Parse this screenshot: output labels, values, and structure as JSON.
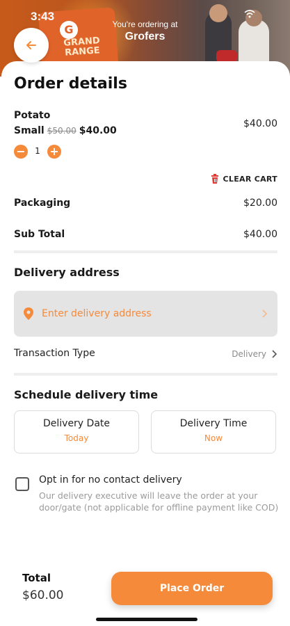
{
  "status_bar": {
    "time": "3:43"
  },
  "banner": {
    "ordering_at": "You're ordering at",
    "store_name": "Grofers",
    "bag_text": "GRAND RANGE",
    "bag_logo": "G"
  },
  "back_icon": "arrow-left-icon",
  "order": {
    "title": "Order details",
    "item": {
      "name": "Potato",
      "variant": "Small",
      "old_price": "$50.00",
      "new_price": "$40.00",
      "line_total": "$40.00",
      "quantity": "1",
      "minus": "−",
      "plus": "+"
    },
    "clear_cart": "CLEAR CART",
    "packaging_label": "Packaging",
    "packaging_value": "$20.00",
    "subtotal_label": "Sub Total",
    "subtotal_value": "$40.00"
  },
  "delivery": {
    "section_title": "Delivery address",
    "address_placeholder": "Enter delivery address",
    "transaction_label": "Transaction Type",
    "transaction_value": "Delivery"
  },
  "schedule": {
    "section_title": "Schedule delivery time",
    "date_label": "Delivery Date",
    "date_value": "Today",
    "time_label": "Delivery Time",
    "time_value": "Now"
  },
  "no_contact": {
    "title": "Opt in for no contact delivery",
    "description": "Our delivery executive will leave the order at your door/gate (not applicable for offline payment like COD)"
  },
  "footer": {
    "total_label": "Total",
    "total_value": "$60.00",
    "place_order": "Place Order"
  },
  "colors": {
    "accent": "#f58a3a",
    "danger": "#e53935"
  }
}
